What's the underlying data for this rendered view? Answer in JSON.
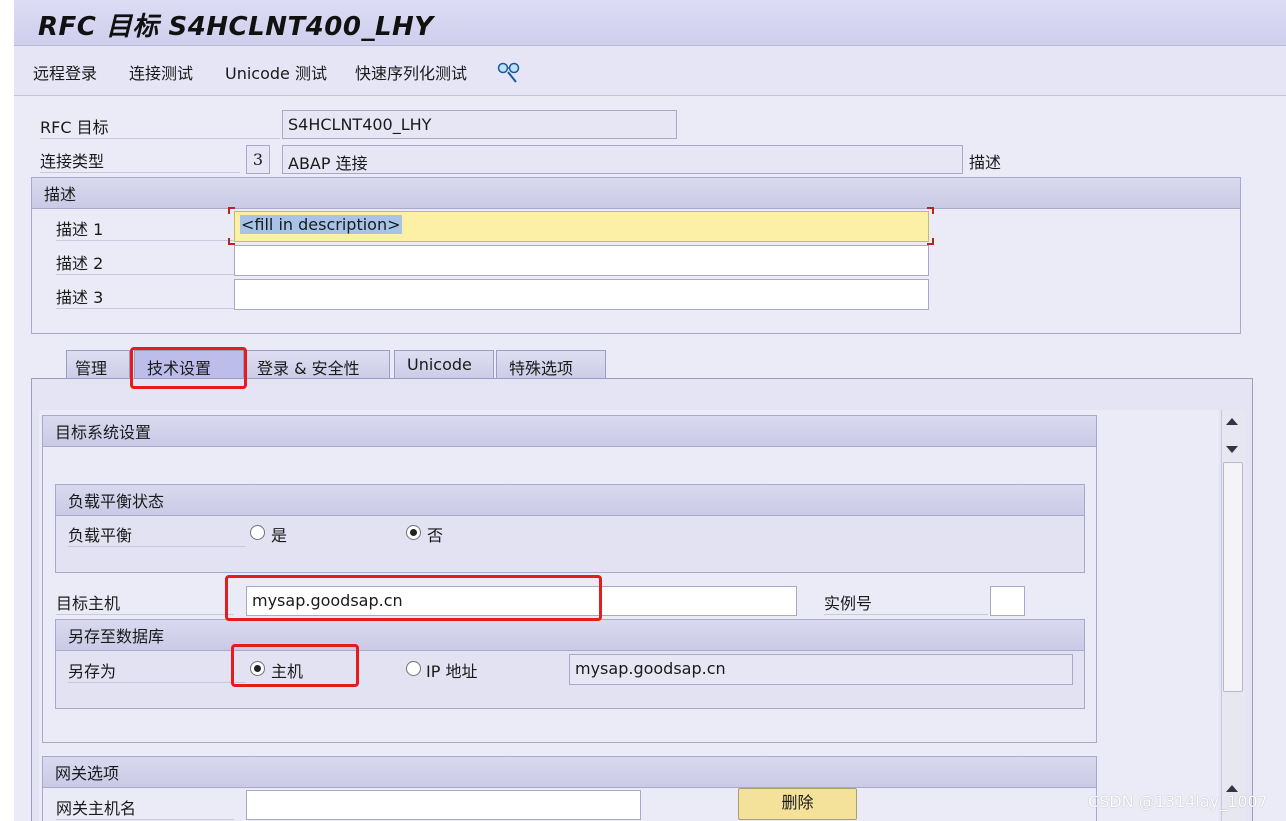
{
  "window": {
    "title": "RFC 目标 S4HCLNT400_LHY"
  },
  "toolbar": {
    "remote_login": "远程登录",
    "connection_test": "连接测试",
    "unicode_test": "Unicode 测试",
    "fast_serialization_test": "快速序列化测试"
  },
  "header": {
    "rfc_destination_label": "RFC 目标",
    "rfc_destination_value": "S4HCLNT400_LHY",
    "connection_type_label": "连接类型",
    "connection_type_code": "3",
    "connection_type_value": "ABAP 连接",
    "description_link": "描述"
  },
  "description": {
    "group_title": "描述",
    "desc1_label": "描述 1",
    "desc1_value": "<fill in description>",
    "desc2_label": "描述 2",
    "desc2_value": "",
    "desc3_label": "描述 3",
    "desc3_value": ""
  },
  "tabs": [
    {
      "label": "管理"
    },
    {
      "label": "技术设置"
    },
    {
      "label": "登录 & 安全性"
    },
    {
      "label": "Unicode"
    },
    {
      "label": "特殊选项"
    }
  ],
  "active_tab": "技术设置",
  "target_system": {
    "group_title": "目标系统设置",
    "load_balance_group_title": "负载平衡状态",
    "load_balance_label": "负载平衡",
    "option_yes": "是",
    "option_no": "否",
    "load_balance_selected": "否",
    "target_host_label": "目标主机",
    "target_host_value": "mysap.goodsap.cn",
    "instance_no_label": "实例号",
    "instance_no_value": "",
    "save_db_group_title": "另存至数据库",
    "save_as_label": "另存为",
    "option_host": "主机",
    "option_ip": "IP 地址",
    "save_as_selected": "主机",
    "save_as_value": "mysap.goodsap.cn"
  },
  "gateway": {
    "group_title": "网关选项",
    "gateway_host_label": "网关主机名",
    "gateway_host_value": "",
    "delete_button": "删除"
  },
  "watermark": "CSDN @1314lay_1007",
  "colors": {
    "title_bar": "#d5d5f1",
    "highlight_field": "#fbf0a6",
    "annotation_red": "#e41c1c",
    "delete_button": "#f4e29a"
  }
}
